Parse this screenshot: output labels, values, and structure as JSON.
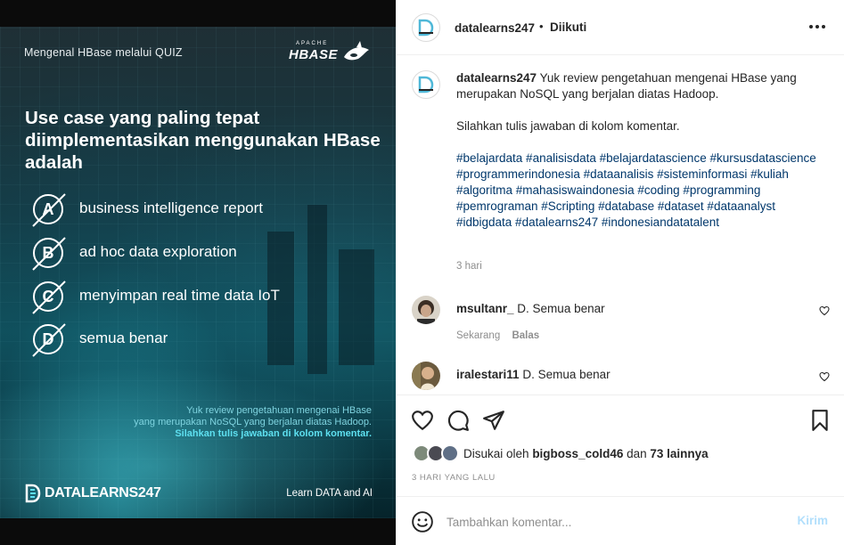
{
  "image": {
    "subtitle": "Mengenal HBase melalui QUIZ",
    "logo_top": "APACHE",
    "logo_main": "HBASE",
    "question": "Use case yang paling tepat diimplementasikan menggunakan HBase adalah",
    "options": [
      {
        "letter": "A",
        "text": "business intelligence report"
      },
      {
        "letter": "B",
        "text": "ad hoc data exploration"
      },
      {
        "letter": "C",
        "text": "menyimpan real time data IoT"
      },
      {
        "letter": "D",
        "text": "semua benar"
      }
    ],
    "overlay_line1": "Yuk review pengetahuan mengenai HBase",
    "overlay_line2": "yang merupakan NoSQL yang berjalan diatas Hadoop.",
    "overlay_line3": "Silahkan tulis jawaban di kolom komentar.",
    "brand": "DATALEARNS247",
    "tagline": "Learn DATA and AI"
  },
  "header": {
    "username": "datalearns247",
    "dot": "•",
    "follow_status": "Diikuti"
  },
  "caption": {
    "username": "datalearns247",
    "text": "Yuk review pengetahuan mengenai HBase yang merupakan NoSQL yang berjalan diatas Hadoop.",
    "text2": "Silahkan tulis jawaban di kolom komentar.",
    "hashtags": "#belajardata #analisisdata #belajardatascience #kursusdatascience #programmerindonesia #dataanalisis #sisteminformasi #kuliah #algoritma #mahasiswaindonesia #coding #programming #pemrograman #Scripting #database #dataset #dataanalyst #idbigdata #datalearns247 #indonesiandatatalent",
    "time": "3 hari"
  },
  "comments": [
    {
      "username": "msultanr_",
      "text": "D. Semua benar",
      "time": "Sekarang",
      "reply": "Balas"
    },
    {
      "username": "iralestari11",
      "text": "D. Semua benar"
    }
  ],
  "likes": {
    "prefix": "Disukai oleh",
    "user": "bigboss_cold46",
    "middle": "dan",
    "others": "73 lainnya"
  },
  "post_date": "3 HARI YANG LALU",
  "add_comment": {
    "placeholder": "Tambahkan komentar...",
    "post_label": "Kirim"
  },
  "colors": {
    "link": "#00376b",
    "post_button_disabled": "#b2dffc",
    "accent_cyan": "#5ee0f0"
  },
  "icons": [
    "heart-icon",
    "comment-icon",
    "share-icon",
    "bookmark-icon",
    "emoji-icon",
    "more-icon"
  ]
}
